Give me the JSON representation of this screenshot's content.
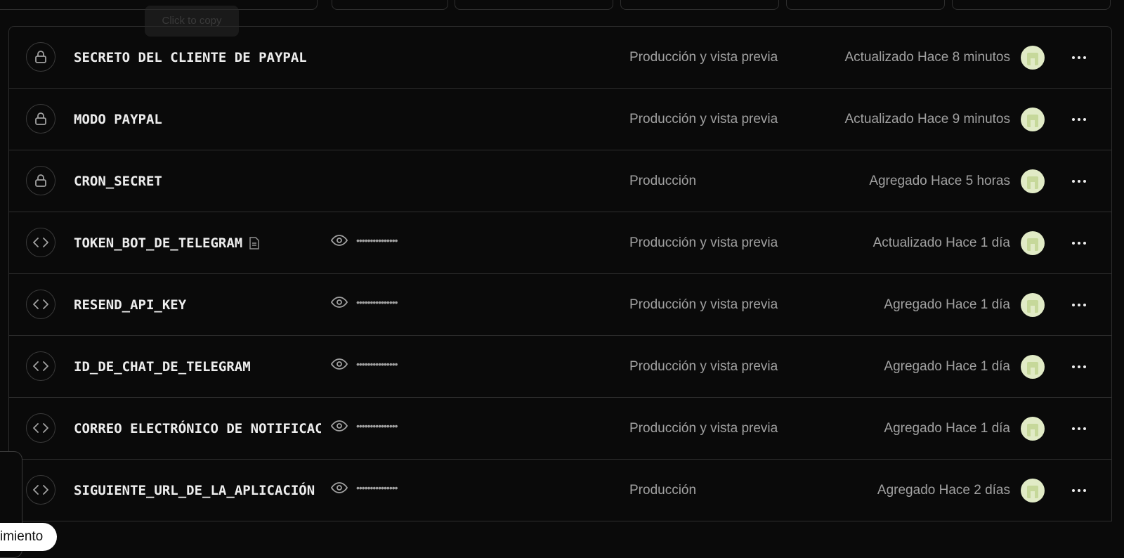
{
  "tooltip": {
    "text": "Click to copy"
  },
  "variables": [
    {
      "type": "secret",
      "type_icon": "lock-icon",
      "name": "SECRETO DEL CLIENTE DE PAYPAL",
      "has_note": false,
      "masked_value": "",
      "environments": "Producción y vista previa",
      "updated": "Actualizado Hace 8 minutos"
    },
    {
      "type": "secret",
      "type_icon": "lock-icon",
      "name": "MODO PAYPAL",
      "has_note": false,
      "masked_value": "",
      "environments": "Producción y vista previa",
      "updated": "Actualizado Hace 9 minutos"
    },
    {
      "type": "secret",
      "type_icon": "lock-icon",
      "name": "CRON_SECRET",
      "has_note": false,
      "masked_value": "",
      "environments": "Producción",
      "updated": "Agregado Hace 5 horas"
    },
    {
      "type": "plain",
      "type_icon": "code-icon",
      "name": "TOKEN_BOT_DE_TELEGRAM",
      "has_note": true,
      "masked_value": "•••••••••••••••",
      "environments": "Producción y vista previa",
      "updated": "Actualizado Hace 1 día"
    },
    {
      "type": "plain",
      "type_icon": "code-icon",
      "name": "RESEND_API_KEY",
      "has_note": false,
      "masked_value": "•••••••••••••••",
      "environments": "Producción y vista previa",
      "updated": "Agregado Hace 1 día"
    },
    {
      "type": "plain",
      "type_icon": "code-icon",
      "name": "ID_DE_CHAT_DE_TELEGRAM",
      "has_note": false,
      "masked_value": "•••••••••••••••",
      "environments": "Producción y vista previa",
      "updated": "Agregado Hace 1 día"
    },
    {
      "type": "plain",
      "type_icon": "code-icon",
      "name": "CORREO ELECTRÓNICO DE NOTIFICACIÓN",
      "has_note": false,
      "masked_value": "•••••••••••••••",
      "environments": "Producción y vista previa",
      "updated": "Agregado Hace 1 día"
    },
    {
      "type": "plain",
      "type_icon": "code-icon",
      "name": "SIGUIENTE_URL_DE_LA_APLICACIÓN",
      "has_note": false,
      "masked_value": "•••••••••••••••",
      "environments": "Producción",
      "updated": "Agregado Hace 2 días"
    }
  ],
  "floating_pill": {
    "text": "imiento"
  },
  "colors": {
    "background": "#0a0a0a",
    "border": "#2e2e2e",
    "muted_text": "#a1a1a1",
    "avatar": "#e1ebc6"
  }
}
